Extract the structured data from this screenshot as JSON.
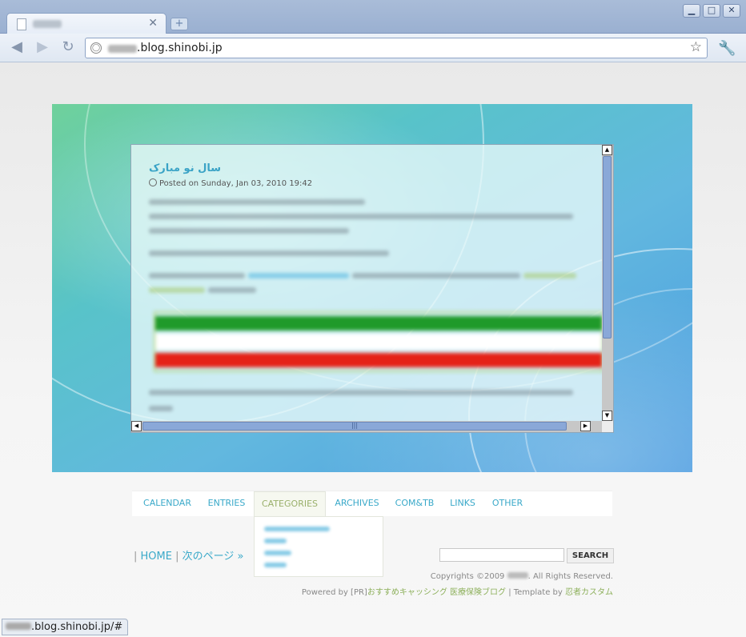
{
  "browser": {
    "tab": {
      "close_glyph": "✕"
    },
    "new_tab_glyph": "+",
    "window_buttons": [
      "▁",
      "□",
      "✕"
    ],
    "nav": {
      "back_glyph": "◀",
      "forward_glyph": "▶",
      "reload_glyph": "↻"
    },
    "address_bar": {
      "url_suffix": ".blog.shinobi.jp"
    },
    "star_glyph": "☆",
    "wrench_glyph": "🔧"
  },
  "post": {
    "title": "سال نو مبارک",
    "date": "Posted on Sunday, Jan 03, 2010 19:42"
  },
  "menu": {
    "items": [
      "CALENDAR",
      "ENTRIES",
      "CATEGORIES",
      "ARCHIVES",
      "COM&TB",
      "LINKS",
      "OTHER"
    ],
    "active": "CATEGORIES"
  },
  "pager": {
    "home": "HOME",
    "next": "次のページ »",
    "separator": "|"
  },
  "search": {
    "button": "SEARCH"
  },
  "footer": {
    "copyright_prefix": "Copyrights ©2009",
    "copyright_suffix": ". All Rights Reserved.",
    "powered_prefix": "Powered by [PR]",
    "powered_link1": "おすすめキャッシング",
    "powered_link2": "医療保険ブログ",
    "template_prefix": " | Template by ",
    "template_link": "忍者カスタム"
  },
  "status": {
    "url_suffix": ".blog.shinobi.jp/#"
  },
  "colors": {
    "accent": "#3aa9c9",
    "green": "#8db05b",
    "scroll_thumb": "#8aa8d8"
  }
}
